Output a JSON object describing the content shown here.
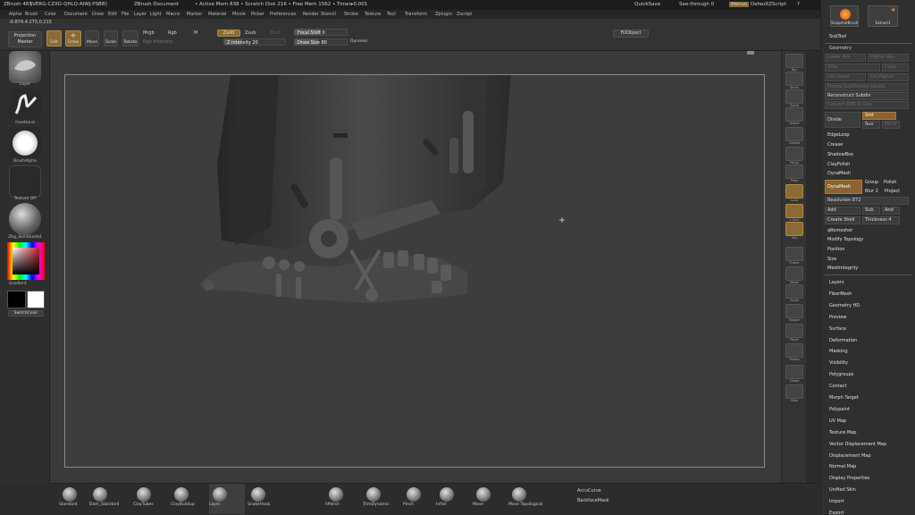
{
  "titlebar": {
    "app": "ZBrush 4R5",
    "version_info": "[VERG-CZXO-QHLQ-AIWJ-PSBB]",
    "document": "ZBrush Document",
    "stats": "• Active Mem 838 • Scratch Disk 216 • Free Mem 1562 • Timer▸0.001",
    "quicksave": "QuickSave",
    "seethrough": "See-through  0",
    "menus_btn": "Menus",
    "script": "DefaultZScript"
  },
  "menubar": [
    "Alpha",
    "Brush",
    "Color",
    "Document",
    "Draw",
    "Edit",
    "File",
    "Layer",
    "Light",
    "Macro",
    "Marker",
    "Material",
    "Movie",
    "Picker",
    "Preferences",
    "Render",
    "Stencil",
    "Stroke",
    "Texture",
    "Tool",
    "Transform",
    "Zplugin",
    "Zscript"
  ],
  "shelf": {
    "coords": "-0.874,4.275,0.215",
    "projection_master": "Projection Master",
    "edit": "Edit",
    "draw": "Draw",
    "move": "Move",
    "scale": "Scale",
    "rotate": "Rotate",
    "mrgb": "Mrgb",
    "rgb": "Rgb",
    "m": "M",
    "rgb_intensity": "Rgb Intensity",
    "zadd": "Zadd",
    "zsub": "Zsub",
    "zcut": "Zcut",
    "z_intensity": "Z Intensity 20",
    "focal_shift": "Focal Shift 0",
    "draw_size": "Draw Size 80",
    "dynamic": "Dynamic",
    "fillobject": "FillObject"
  },
  "lefttray": {
    "brush": "Layer",
    "stroke": "FreeHand",
    "alpha": "BrushAlpha",
    "texture": "Texture Off",
    "material": "Zbg_SkinShade4",
    "gradient": "Gradient",
    "switchcolor": "SwitchColor"
  },
  "rightcol": [
    "Bpr",
    "Scroll",
    "Zoom",
    "Actual",
    "AAHalf",
    "Persp",
    "Floor",
    "Local",
    "L.Sym",
    "Xyz",
    "Frame",
    "Move",
    "Scale",
    "Rotate",
    "PolyF",
    "Transp",
    "Ghost",
    "Solo"
  ],
  "rpanel": {
    "snapshot": "SnapshotBrush",
    "extract": "Extract1",
    "subtool": "SubTool",
    "geometry": "Geometry",
    "lower_res": "Lower Res",
    "higher_res": "Higher Res",
    "sdiv": "SDiv",
    "cage": "Cage",
    "rstr": "Rstr",
    "del_lower": "Del Lower",
    "del_higher": "Del Higher",
    "freeze": "Freeze SubDivision Levels",
    "reconstruct": "Reconstruct Subdiv",
    "convert_bpr": "Convert BPR To Geo",
    "divide": "Divide",
    "smt": "Smt",
    "suv": "Suv",
    "reuv": "ReUV",
    "edgeloop": "EdgeLoop",
    "crease": "Crease",
    "shadowbox": "ShadowBox",
    "claypolish": "ClayPolish",
    "dynamesh": "DynaMesh",
    "dynamesh_btn": "DynaMesh",
    "group": "Group",
    "polish": "Polish",
    "blur": "Blur 2",
    "project": "Project",
    "resolution": "Resolution 872",
    "add": "Add",
    "sub": "Sub",
    "and": "And",
    "create_shell": "Create Shell",
    "thickness": "Thickness 4",
    "qremesher": "qRemesher",
    "modify_topology": "Modify Topology",
    "position": "Position",
    "size": "Size",
    "meshintegrity": "MeshIntegrity",
    "sections": [
      "Layers",
      "FiberMesh",
      "Geometry HD",
      "Preview",
      "Surface",
      "Deformation",
      "Masking",
      "Visibility",
      "Polygroups",
      "Contact",
      "Morph Target",
      "Polypaint",
      "UV Map",
      "Texture Map",
      "Vector Displacement Map",
      "Displacement Map",
      "Normal Map",
      "Display Properties",
      "Unified Skin",
      "Import",
      "Export"
    ]
  },
  "bottom": {
    "brushes": [
      "Standard",
      "Dam_Standard",
      "ClayTubes",
      "ClayBuildup",
      "Layer",
      "SnakeHook",
      "hPolish",
      "TrimDynamic",
      "Pinch",
      "Inflat",
      "Move",
      "Move Topological"
    ],
    "accucurve": "AccuCurve",
    "backfacemask": "BackfaceMask"
  }
}
